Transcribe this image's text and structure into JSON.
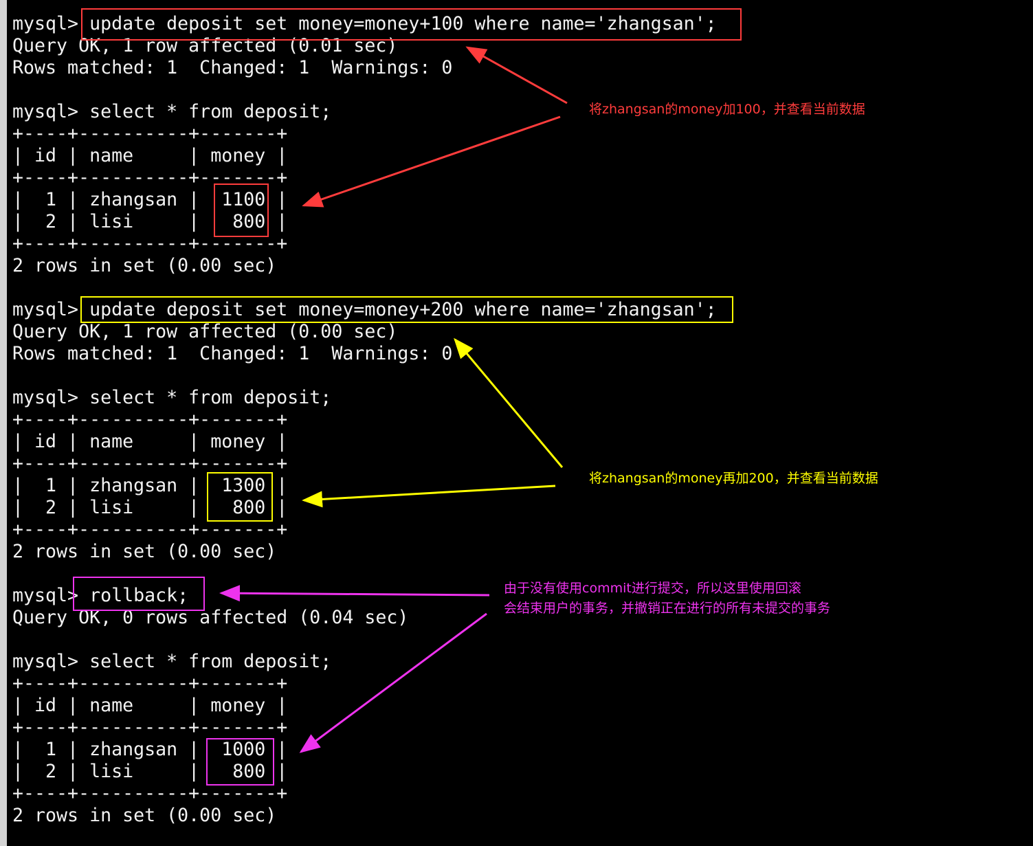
{
  "terminal": {
    "lines": [
      "mysql> update deposit set money=money+100 where name='zhangsan';",
      "Query OK, 1 row affected (0.01 sec)",
      "Rows matched: 1  Changed: 1  Warnings: 0",
      "",
      "mysql> select * from deposit;",
      "+----+----------+-------+",
      "| id | name     | money |",
      "+----+----------+-------+",
      "|  1 | zhangsan |  1100 |",
      "|  2 | lisi     |   800 |",
      "+----+----------+-------+",
      "2 rows in set (0.00 sec)",
      "",
      "mysql> update deposit set money=money+200 where name='zhangsan';",
      "Query OK, 1 row affected (0.00 sec)",
      "Rows matched: 1  Changed: 1  Warnings: 0",
      "",
      "mysql> select * from deposit;",
      "+----+----------+-------+",
      "| id | name     | money |",
      "+----+----------+-------+",
      "|  1 | zhangsan |  1300 |",
      "|  2 | lisi     |   800 |",
      "+----+----------+-------+",
      "2 rows in set (0.00 sec)",
      "",
      "mysql> rollback;",
      "Query OK, 0 rows affected (0.04 sec)",
      "",
      "mysql> select * from deposit;",
      "+----+----------+-------+",
      "| id | name     | money |",
      "+----+----------+-------+",
      "|  1 | zhangsan |  1000 |",
      "|  2 | lisi     |   800 |",
      "+----+----------+-------+",
      "2 rows in set (0.00 sec)"
    ]
  },
  "annotations": {
    "first_update": {
      "text": "将zhangsan的money加100，并查看当前数据",
      "color": "#ff3c3c"
    },
    "second_update": {
      "text": "将zhangsan的money再加200，并查看当前数据",
      "color": "#ffff00"
    },
    "rollback": {
      "line1": "由于没有使用commit进行提交，所以这里使用回滚",
      "line2": "会结束用户的事务，并撤销正在进行的所有未提交的事务",
      "color": "#ee33ee"
    }
  }
}
